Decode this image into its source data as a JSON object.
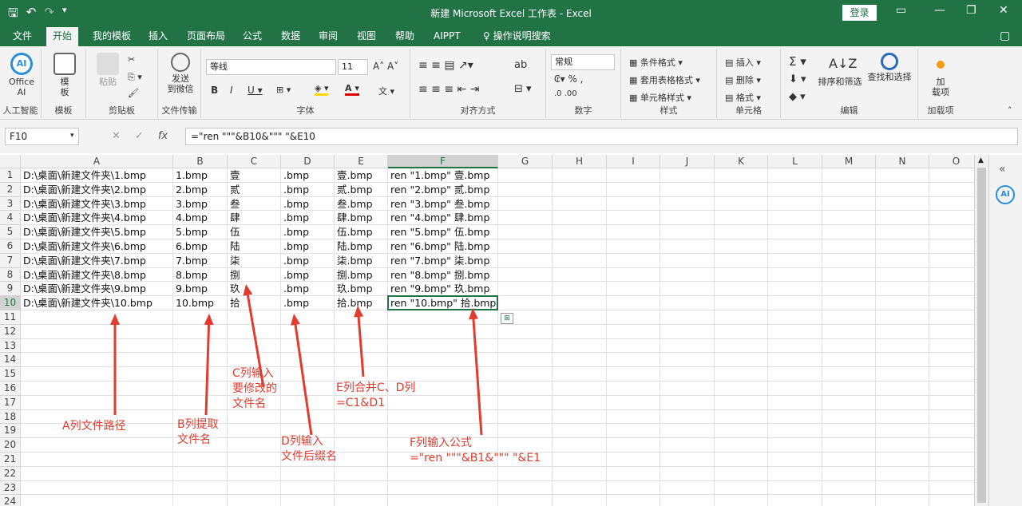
{
  "title_bar": {
    "title": "新建 Microsoft Excel 工作表  -  Excel",
    "login": "登录"
  },
  "tabs": [
    "文件",
    "开始",
    "我的模板",
    "插入",
    "页面布局",
    "公式",
    "数据",
    "审阅",
    "视图",
    "帮助",
    "AIPPT",
    "操作说明搜索"
  ],
  "ribbon": {
    "groups": {
      "ai": "人工智能",
      "template": "模板",
      "clipboard": "剪贴板",
      "transfer": "文件传输",
      "font": "字体",
      "align": "对齐方式",
      "number": "数字",
      "styles": "样式",
      "cells": "单元格",
      "edit": "编辑",
      "addins": "加载项"
    },
    "buttons": {
      "office_ai": "Office\nAI",
      "template": "模\n板",
      "paste": "粘贴",
      "send": "发送\n到微信",
      "font_name": "等线",
      "font_size": "11",
      "number_format": "常规",
      "cond_format": "条件格式",
      "table_format": "套用表格格式",
      "cell_style": "单元格样式",
      "insert": "插入",
      "delete": "删除",
      "format": "格式",
      "sort_filter": "排序和筛选",
      "find_select": "查找和选择",
      "addin": "加\n载项"
    }
  },
  "formula_bar": {
    "name_box": "F10",
    "formula": "=\"ren \"\"\"&B10&\"\"\" \"&E10"
  },
  "columns": [
    "A",
    "B",
    "C",
    "D",
    "E",
    "F",
    "G",
    "H",
    "I",
    "J",
    "K",
    "L",
    "M",
    "N",
    "O"
  ],
  "rows": [
    "1",
    "2",
    "3",
    "4",
    "5",
    "6",
    "7",
    "8",
    "9",
    "10",
    "11",
    "12",
    "13",
    "14",
    "15",
    "16",
    "17",
    "18",
    "19",
    "20",
    "21",
    "22",
    "23",
    "24"
  ],
  "cells": {
    "A": [
      "D:\\桌面\\新建文件夹\\1.bmp",
      "D:\\桌面\\新建文件夹\\2.bmp",
      "D:\\桌面\\新建文件夹\\3.bmp",
      "D:\\桌面\\新建文件夹\\4.bmp",
      "D:\\桌面\\新建文件夹\\5.bmp",
      "D:\\桌面\\新建文件夹\\6.bmp",
      "D:\\桌面\\新建文件夹\\7.bmp",
      "D:\\桌面\\新建文件夹\\8.bmp",
      "D:\\桌面\\新建文件夹\\9.bmp",
      "D:\\桌面\\新建文件夹\\10.bmp"
    ],
    "B": [
      "1.bmp",
      "2.bmp",
      "3.bmp",
      "4.bmp",
      "5.bmp",
      "6.bmp",
      "7.bmp",
      "8.bmp",
      "9.bmp",
      "10.bmp"
    ],
    "C": [
      "壹",
      "贰",
      "叁",
      "肆",
      "伍",
      "陆",
      "柒",
      "捌",
      "玖",
      "拾"
    ],
    "D": [
      ".bmp",
      ".bmp",
      ".bmp",
      ".bmp",
      ".bmp",
      ".bmp",
      ".bmp",
      ".bmp",
      ".bmp",
      ".bmp"
    ],
    "E": [
      "壹.bmp",
      "贰.bmp",
      "叁.bmp",
      "肆.bmp",
      "伍.bmp",
      "陆.bmp",
      "柒.bmp",
      "捌.bmp",
      "玖.bmp",
      "拾.bmp"
    ],
    "F": [
      "ren \"1.bmp\" 壹.bmp",
      "ren \"2.bmp\" 贰.bmp",
      "ren \"3.bmp\" 叁.bmp",
      "ren \"4.bmp\" 肆.bmp",
      "ren \"5.bmp\" 伍.bmp",
      "ren \"6.bmp\" 陆.bmp",
      "ren \"7.bmp\" 柒.bmp",
      "ren \"8.bmp\" 捌.bmp",
      "ren \"9.bmp\" 玖.bmp",
      "ren \"10.bmp\" 拾.bmp"
    ]
  },
  "annotations": {
    "a": "A列文件路径",
    "b": "B列提取\n文件名",
    "c": "C列输入\n要修改的\n文件名",
    "d": "D列输入\n文件后缀名",
    "e": "E列合并C、D列\n=C1&D1",
    "f": "F列输入公式\n=\"ren \"\"\"&B1&\"\"\" \"&E1"
  },
  "colors": {
    "excel_green": "#217346",
    "annotation_red": "#e33b2e"
  }
}
